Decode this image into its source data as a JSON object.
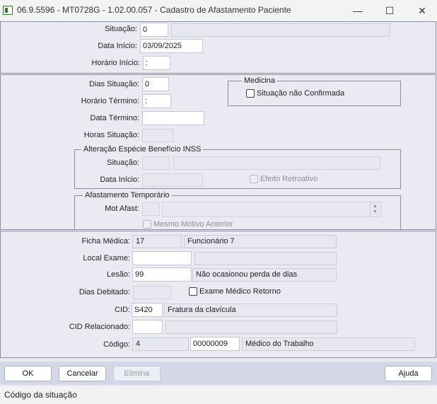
{
  "window": {
    "title": "06.9.5596 - MT0728G - 1.02.00.057 - Cadastro de Afastamento Paciente",
    "minimize_glyph": "—",
    "maximize_glyph": "☐",
    "close_glyph": "✕"
  },
  "top": {
    "situacao_label": "Situação:",
    "situacao_value": "0",
    "situacao_desc": "",
    "data_inicio_label": "Data Início:",
    "data_inicio_value": "03/09/2025",
    "horario_inicio_label": "Horário Início:",
    "horario_inicio_value": " :"
  },
  "middle": {
    "dias_situacao_label": "Dias Situação:",
    "dias_situacao_value": "0",
    "horario_termino_label": "Horário Término:",
    "horario_termino_value": " :",
    "data_termino_label": "Data Término:",
    "data_termino_value": "",
    "horas_situacao_label": "Horas Situação:",
    "horas_situacao_value": "",
    "medicina": {
      "title": "Medicina",
      "checkbox_label": "Situação não Confirmada",
      "checked": false
    },
    "inss": {
      "title": "Alteração Espécie Benefício INSS",
      "situacao_label": "Situação:",
      "situacao_value": "",
      "situacao_desc": "",
      "data_inicio_label": "Data Início:",
      "data_inicio_value": "",
      "efeito_label": "Efeito Retroativo",
      "efeito_checked": false
    },
    "temp": {
      "title": "Afastamento Temporário",
      "mot_afast_label": "Mot Afast:",
      "mot_afast_value": "",
      "mot_afast_desc": "",
      "mesmo_motivo_label": "Mesmo Motivo Anterior",
      "mesmo_motivo_checked": false
    }
  },
  "bottom": {
    "ficha_label": "Ficha Médica:",
    "ficha_value": "17",
    "ficha_desc": "Funcionário 7",
    "local_label": "Local Exame:",
    "local_value": "",
    "local_desc": "",
    "lesao_label": "Lesão:",
    "lesao_value": "99",
    "lesao_desc": "Não ocasionou perda de dias",
    "dias_debitado_label": "Dias Debitado:",
    "dias_debitado_value": "",
    "exame_label": "Exame Médico Retorno",
    "exame_checked": false,
    "cid_label": "CID:",
    "cid_value": "S420",
    "cid_desc": "Fratura da clavícula",
    "cid_rel_label": "CID Relacionado:",
    "cid_rel_value": "",
    "cid_rel_desc": "",
    "codigo_label": "Código:",
    "codigo_value": "4",
    "codigo_num": "00000009",
    "codigo_desc": "Médico do Trabalho"
  },
  "buttons": {
    "ok": "OK",
    "cancelar": "Cancelar",
    "elimina": "Elimina",
    "ajuda": "Ajuda"
  },
  "status": "Código da situação"
}
